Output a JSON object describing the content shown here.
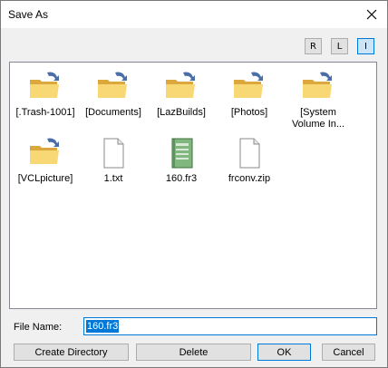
{
  "window": {
    "title": "Save As"
  },
  "view_modes": [
    {
      "label": "R",
      "active": false
    },
    {
      "label": "L",
      "active": false
    },
    {
      "label": "I",
      "active": true
    }
  ],
  "files": [
    {
      "label": "[.Trash-1001]",
      "type": "folder"
    },
    {
      "label": "[Documents]",
      "type": "folder"
    },
    {
      "label": "[LazBuilds]",
      "type": "folder"
    },
    {
      "label": "[Photos]",
      "type": "folder"
    },
    {
      "label_line1": "[System",
      "label_line2": "Volume In...",
      "type": "folder"
    },
    {
      "label": "[VCLpicture]",
      "type": "folder"
    },
    {
      "label": "1.txt",
      "type": "text-file"
    },
    {
      "label": "160.fr3",
      "type": "report-file"
    },
    {
      "label": "frconv.zip",
      "type": "text-file"
    }
  ],
  "filename": {
    "label": "File Name:",
    "value": "160.fr3"
  },
  "buttons": {
    "create_directory": "Create Directory",
    "delete": "Delete",
    "ok": "OK",
    "cancel": "Cancel"
  },
  "colors": {
    "accent": "#0078d7",
    "folder": "#f8d775",
    "report_icon": "#7fb77e"
  },
  "icons": {
    "folder": "shared-folder-icon",
    "text_file": "document-icon",
    "report_file": "green-notebook-icon",
    "close": "close-icon"
  }
}
